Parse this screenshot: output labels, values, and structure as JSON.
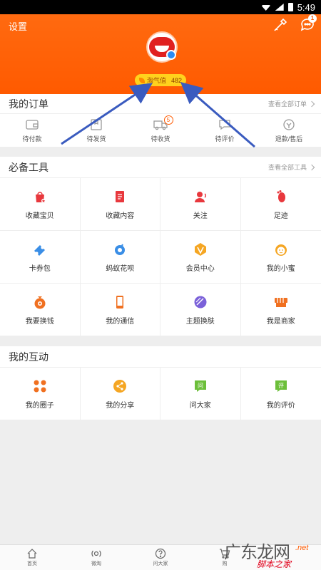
{
  "status_bar": {
    "time": "5:49"
  },
  "header": {
    "settings_label": "设置",
    "message_badge": "1",
    "taoqi_label": "淘气值",
    "taoqi_value": "482"
  },
  "orders": {
    "title": "我的订单",
    "more": "查看全部订单",
    "items": [
      {
        "label": "待付款",
        "icon": "wallet-icon"
      },
      {
        "label": "待发货",
        "icon": "package-icon"
      },
      {
        "label": "待收货",
        "icon": "truck-icon",
        "badge": "5"
      },
      {
        "label": "待评价",
        "icon": "comment-icon"
      },
      {
        "label": "退款/售后",
        "icon": "refund-icon"
      }
    ]
  },
  "tools": {
    "title": "必备工具",
    "more": "查看全部工具",
    "items": [
      {
        "label": "收藏宝贝",
        "icon": "favorite-bag-icon",
        "color": "#e8383d"
      },
      {
        "label": "收藏内容",
        "icon": "favorite-content-icon",
        "color": "#e8383d"
      },
      {
        "label": "关注",
        "icon": "follow-icon",
        "color": "#e8383d"
      },
      {
        "label": "足迹",
        "icon": "footprint-icon",
        "color": "#e8383d"
      },
      {
        "label": "卡券包",
        "icon": "coupon-icon",
        "color": "#3a8ee6"
      },
      {
        "label": "蚂蚁花呗",
        "icon": "huabei-icon",
        "color": "#3a8ee6"
      },
      {
        "label": "会员中心",
        "icon": "vip-icon",
        "color": "#f5a623"
      },
      {
        "label": "我的小蜜",
        "icon": "assistant-icon",
        "color": "#f5a623"
      },
      {
        "label": "我要换钱",
        "icon": "money-bag-icon",
        "color": "#f07020"
      },
      {
        "label": "我的通信",
        "icon": "phone-icon",
        "color": "#f07020"
      },
      {
        "label": "主题换肤",
        "icon": "theme-icon",
        "color": "#7b61d9"
      },
      {
        "label": "我是商家",
        "icon": "shop-icon",
        "color": "#f07020"
      }
    ]
  },
  "interactions": {
    "title": "我的互动",
    "items": [
      {
        "label": "我的圈子",
        "icon": "circle-group-icon",
        "color": "#f07020"
      },
      {
        "label": "我的分享",
        "icon": "share-icon",
        "color": "#f5a623"
      },
      {
        "label": "问大家",
        "icon": "ask-icon",
        "color": "#6cbf3a"
      },
      {
        "label": "我的评价",
        "icon": "review-icon",
        "color": "#6cbf3a"
      }
    ]
  },
  "bottom_nav": {
    "items": [
      {
        "label": "首页",
        "icon": "home-icon"
      },
      {
        "label": "微淘",
        "icon": "weitao-icon"
      },
      {
        "label": "问大家",
        "icon": "question-icon"
      },
      {
        "label": "购",
        "icon": "cart-icon"
      }
    ]
  },
  "watermark": {
    "main": "广东龙网",
    "net": ".net",
    "sub": "脚本之家"
  }
}
